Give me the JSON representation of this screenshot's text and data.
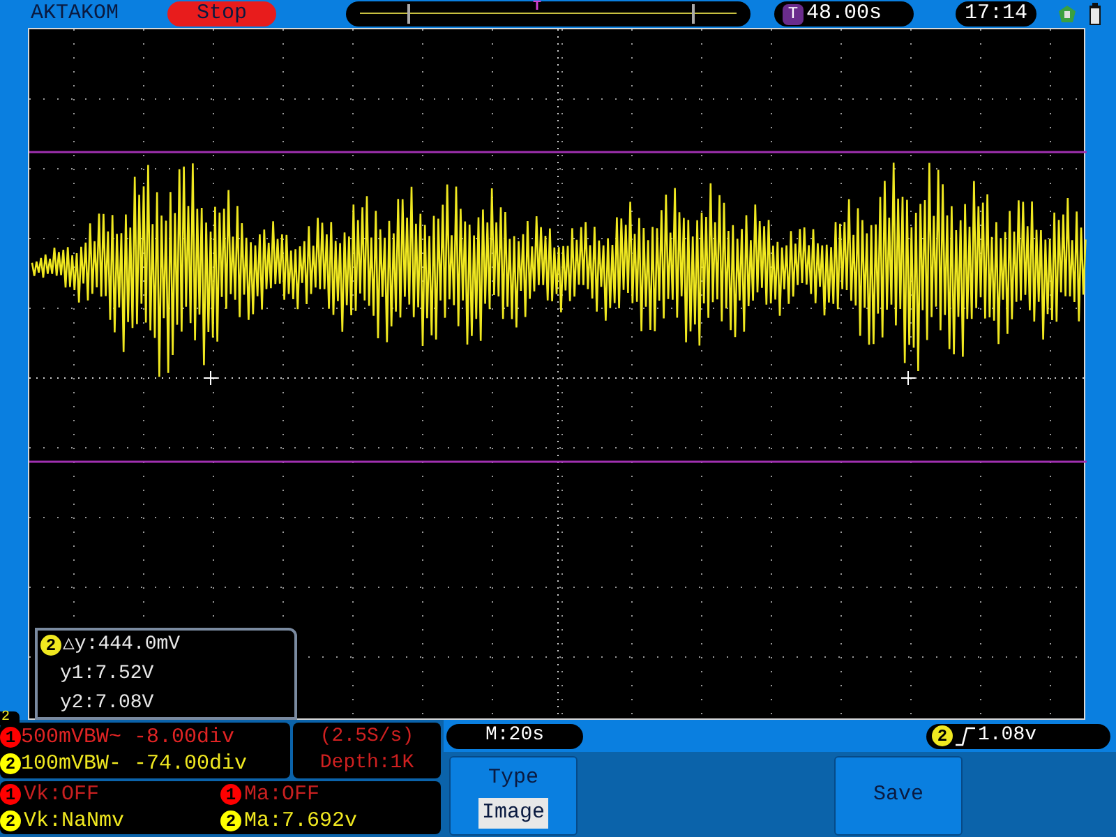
{
  "brand": "AKTAKOM",
  "run_status": "Stop",
  "trigger_position": {
    "marker": "T"
  },
  "trigger_time": {
    "badge": "T",
    "value": "48.00s"
  },
  "clock": "17:14",
  "cursor_readout": {
    "channel": "2",
    "delta": "△y:444.0mV",
    "lines": [
      "y1:7.52V",
      "y2:7.08V"
    ]
  },
  "channel_tab": "2",
  "channel_settings": [
    {
      "channel": "1",
      "color": "#ff0000",
      "text": "500mVBW~ -8.00div"
    },
    {
      "channel": "2",
      "color": "#ffff00",
      "text": "100mVBW- -74.00div"
    }
  ],
  "acquisition": [
    "(2.5S/s)",
    "Depth:1K"
  ],
  "memory": "M:20s",
  "trigger": {
    "channel": "2",
    "level": "1.08v"
  },
  "measurements": [
    {
      "channel": "1",
      "color": "#ff0000",
      "text": "Vk:OFF"
    },
    {
      "channel": "1",
      "color": "#ff0000",
      "text": "Ma:OFF"
    },
    {
      "channel": "2",
      "color": "#ffff00",
      "text": "Vk:NaNmv"
    },
    {
      "channel": "2",
      "color": "#ffff00",
      "text": "Ma:7.692v"
    }
  ],
  "softkeys": [
    {
      "label": "Type",
      "value": "Image"
    },
    {
      "label": "Save"
    }
  ]
}
